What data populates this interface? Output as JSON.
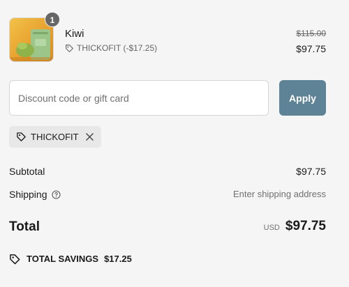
{
  "product": {
    "name": "Kiwi",
    "quantity": "1",
    "discount_label": "THICKOFIT (-$17.25)",
    "original_price": "$115.00",
    "price": "$97.75",
    "image_alt": "Kiwi"
  },
  "discount": {
    "placeholder": "Discount code or gift card",
    "apply_label": "Apply",
    "applied_code": "THICKOFIT"
  },
  "summary": {
    "subtotal_label": "Subtotal",
    "subtotal_value": "$97.75",
    "shipping_label": "Shipping",
    "shipping_value": "Enter shipping address",
    "total_label": "Total",
    "total_currency": "USD",
    "total_value": "$97.75",
    "savings_label": "TOTAL SAVINGS",
    "savings_value": "$17.25"
  },
  "colors": {
    "apply_button": "#5f8396",
    "background": "#f5f5f5",
    "chip_background": "#e8e8e8"
  }
}
